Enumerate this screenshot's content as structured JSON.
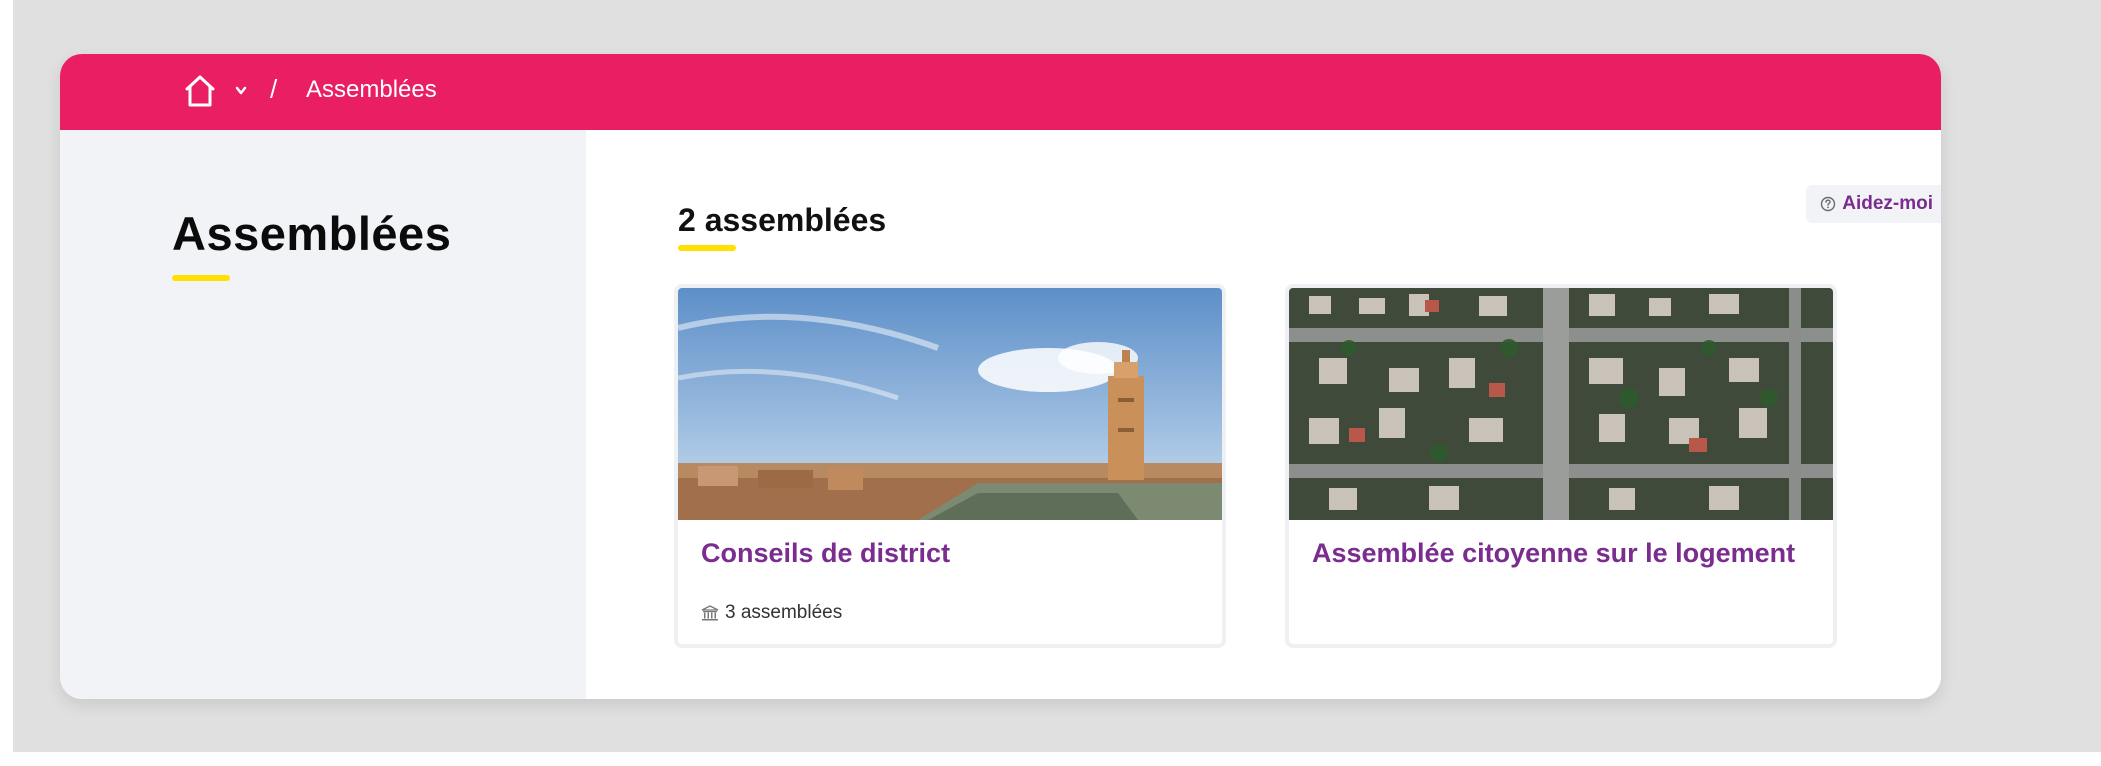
{
  "breadcrumb": {
    "home_icon": "home-icon",
    "dropdown_icon": "chevron-down-icon",
    "separator": "/",
    "current": "Assemblées"
  },
  "sidebar": {
    "title": "Assemblées"
  },
  "main": {
    "count_heading": "2 assemblées",
    "help_label": "Aidez-moi",
    "help_icon": "question-circle-icon"
  },
  "cards": [
    {
      "title": "Conseils de district",
      "meta_icon": "building-icon",
      "meta": "3 assemblées",
      "image": "city-skyline-photo"
    },
    {
      "title": "Assemblée citoyenne sur le logement",
      "image": "aerial-neighborhood-photo"
    }
  ],
  "colors": {
    "topbar": "#e91e63",
    "accent_underline": "#ffe000",
    "link_purple": "#7b2c8f",
    "sidebar_bg": "#f2f3f7"
  }
}
